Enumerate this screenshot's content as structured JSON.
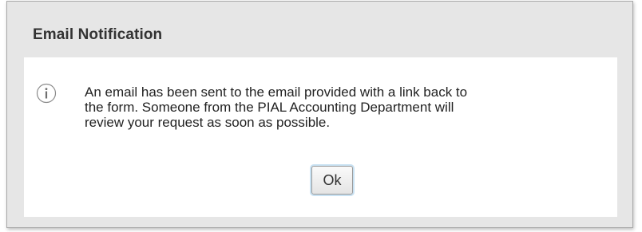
{
  "dialog": {
    "title": "Email Notification",
    "icon": "info-icon",
    "message": "An email has been sent to the email provided with a link back to\nthe form. Someone from the PIAL Accounting Department will\nreview your request as soon as possible.",
    "ok_label": "Ok"
  },
  "colors": {
    "dialog_background": "#e6e6e6",
    "body_background": "#ffffff",
    "button_focus_ring": "#c9e2f3"
  }
}
